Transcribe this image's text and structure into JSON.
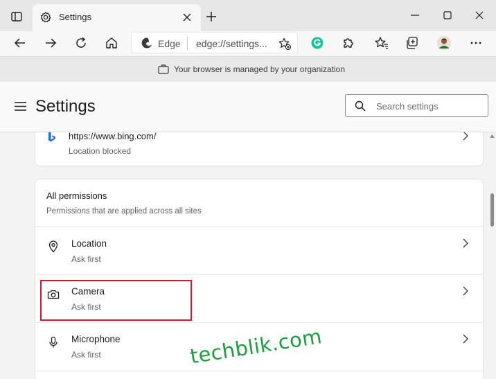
{
  "tab": {
    "title": "Settings"
  },
  "address": {
    "brand": "Edge",
    "url": "edge://settings..."
  },
  "managed_bar": {
    "message": "Your browser is managed by your organization"
  },
  "header": {
    "title": "Settings",
    "search_placeholder": "Search settings"
  },
  "site_entry": {
    "site": "https://www.bing.com/",
    "status": "Location blocked"
  },
  "permissions": {
    "heading": "All permissions",
    "subheading": "Permissions that are applied across all sites",
    "items": [
      {
        "name": "Location",
        "status": "Ask first",
        "icon": "location-pin-icon"
      },
      {
        "name": "Camera",
        "status": "Ask first",
        "icon": "camera-icon"
      },
      {
        "name": "Microphone",
        "status": "Ask first",
        "icon": "microphone-icon"
      }
    ]
  },
  "watermark": "techblik.com",
  "colors": {
    "highlight": "#d9182b",
    "watermark": "#1b9e3e",
    "grammarly": "#15c39a"
  }
}
